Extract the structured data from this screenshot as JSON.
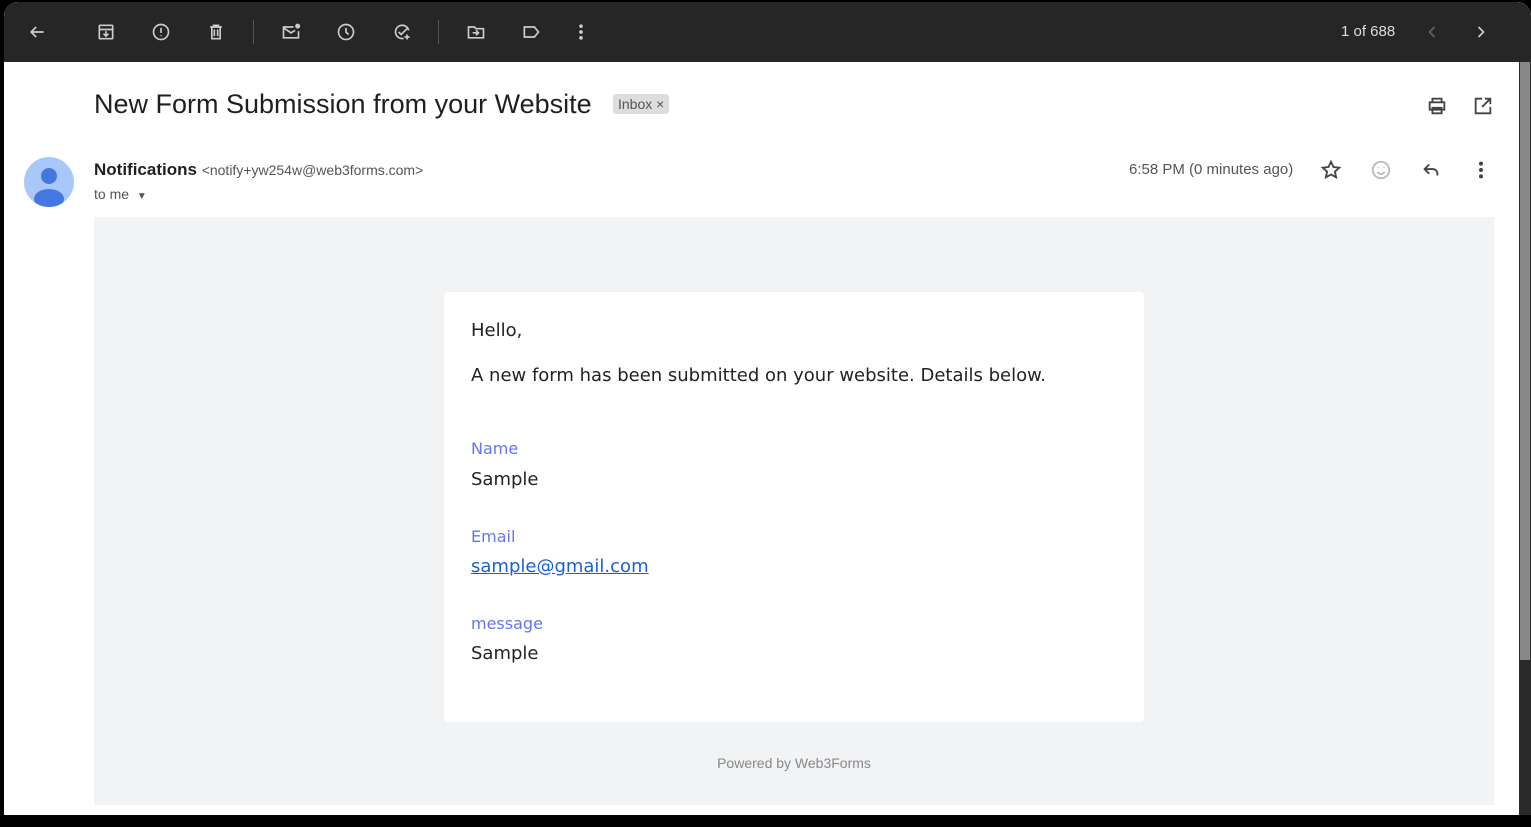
{
  "toolbar": {
    "count": "1 of 688",
    "icons": [
      "back-icon",
      "archive-icon",
      "report-spam-icon",
      "delete-icon",
      "mark-unread-icon",
      "snooze-icon",
      "add-task-icon",
      "move-to-icon",
      "label-icon",
      "more-icon"
    ]
  },
  "email": {
    "subject": "New Form Submission from your Website",
    "label": "Inbox",
    "label_close": "×",
    "sender_name": "Notifications",
    "sender_address": "<notify+yw254w@web3forms.com>",
    "recipient": "to me",
    "time": "6:58 PM (0 minutes ago)"
  },
  "message": {
    "greeting": "Hello,",
    "intro": "A new form has been submitted on your website. Details below.",
    "fields": [
      {
        "key": "Name",
        "value": "Sample"
      },
      {
        "key": "Email",
        "value": "sample@gmail.com"
      },
      {
        "key": "message",
        "value": "Sample"
      }
    ],
    "footer": "Powered by Web3Forms"
  },
  "colors": {
    "field_key": "#6674f0",
    "link": "#1a5fd0",
    "toolbar": "#262626"
  }
}
